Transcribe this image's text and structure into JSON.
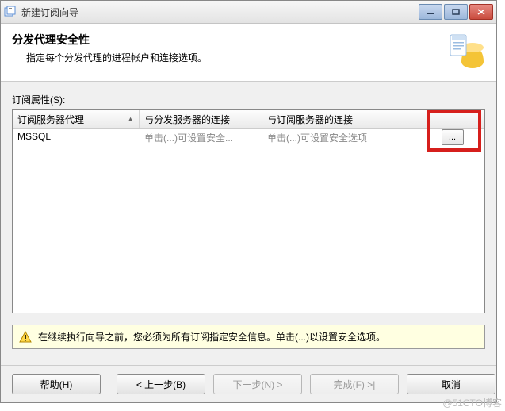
{
  "window": {
    "title": "新建订阅向导"
  },
  "header": {
    "title": "分发代理安全性",
    "subtitle": "指定每个分发代理的进程帐户和连接选项。"
  },
  "list": {
    "label": "订阅属性(S):",
    "columns": {
      "agent": "订阅服务器代理",
      "distributor": "与分发服务器的连接",
      "subscriber": "与订阅服务器的连接"
    },
    "row": {
      "agent": "MSSQL",
      "distributor": "单击(...)可设置安全...",
      "subscriber": "单击(...)可设置安全选项",
      "button": "..."
    }
  },
  "warning": {
    "text": "在继续执行向导之前，您必须为所有订阅指定安全信息。单击(...)以设置安全选项。"
  },
  "buttons": {
    "help": "帮助(H)",
    "back": "< 上一步(B)",
    "next": "下一步(N) >",
    "finish": "完成(F) >|",
    "cancel": "取消"
  },
  "watermark": "@51CTO博客"
}
